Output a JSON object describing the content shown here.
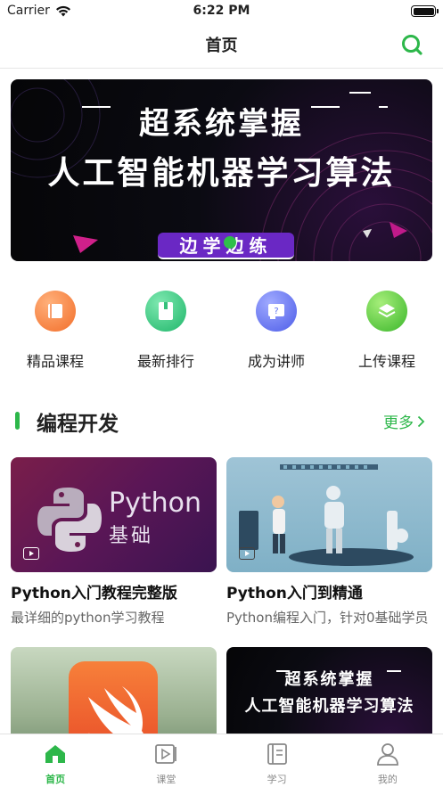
{
  "status_bar": {
    "carrier": "Carrier",
    "time": "6:22 PM"
  },
  "navbar": {
    "title": "首页"
  },
  "banner": {
    "line1": "超系统掌握",
    "line2": "人工智能机器学习算法",
    "pill": "边学边练"
  },
  "quick_entries": [
    {
      "label": "精品课程",
      "icon": "book-icon",
      "color": "#f58a3a"
    },
    {
      "label": "最新排行",
      "icon": "ranking-icon",
      "color": "#2fc27a"
    },
    {
      "label": "成为讲师",
      "icon": "teacher-icon",
      "color": "#5a6ef0"
    },
    {
      "label": "上传课程",
      "icon": "layers-icon",
      "color": "#59c43a"
    }
  ],
  "section": {
    "title": "编程开发",
    "more": "更多"
  },
  "courses": [
    {
      "title": "Python入门教程完整版",
      "subtitle": "最详细的python学习教程",
      "thumb_text1": "Python",
      "thumb_text2": "基础"
    },
    {
      "title": "Python入门到精通",
      "subtitle": "Python编程入门，针对0基础学员"
    },
    {
      "title": "",
      "subtitle": ""
    },
    {
      "title": "",
      "subtitle": "",
      "thumb_text1": "超系统掌握",
      "thumb_text2": "人工智能机器学习算法"
    }
  ],
  "tabbar": [
    {
      "label": "首页",
      "active": true
    },
    {
      "label": "课堂",
      "active": false
    },
    {
      "label": "学习",
      "active": false
    },
    {
      "label": "我的",
      "active": false
    }
  ],
  "colors": {
    "accent": "#2db74a"
  }
}
